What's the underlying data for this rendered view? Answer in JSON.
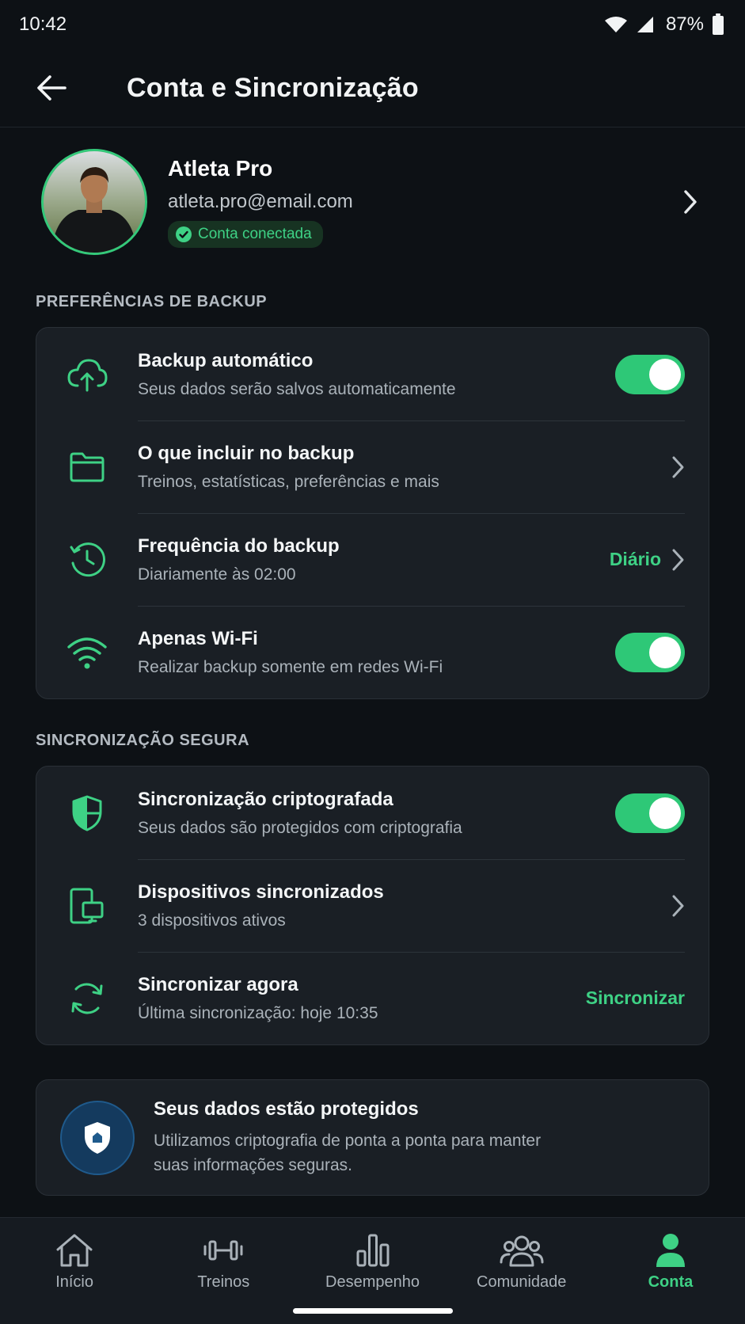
{
  "status_bar": {
    "time": "10:42",
    "battery": "87%"
  },
  "header": {
    "title": "Conta e Sincronização",
    "back_icon": "arrow-left-icon"
  },
  "profile": {
    "name": "Atleta Pro",
    "email": "atleta.pro@email.com",
    "badge": "Conta conectada"
  },
  "backup": {
    "section_title": "PREFERÊNCIAS DE BACKUP",
    "rows": [
      {
        "icon": "cloud-upload-icon",
        "title": "Backup automático",
        "subtitle": "Seus dados serão salvos automaticamente",
        "toggle": true
      },
      {
        "icon": "folder-icon",
        "title": "O que incluir no backup",
        "subtitle": "Treinos, estatísticas, preferências e mais"
      },
      {
        "icon": "clock-icon",
        "title": "Frequência do backup",
        "subtitle": "Diariamente às 02:00",
        "value": "Diário"
      },
      {
        "icon": "wifi-icon",
        "title": "Apenas Wi-Fi",
        "subtitle": "Realizar backup somente em redes Wi-Fi",
        "toggle": true
      }
    ]
  },
  "sync": {
    "section_title": "SINCRONIZAÇÃO SEGURA",
    "rows": [
      {
        "icon": "shield-icon",
        "title": "Sincronização criptografada",
        "subtitle": "Seus dados são protegidos com criptografia",
        "toggle": true
      },
      {
        "icon": "devices-icon",
        "title": "Dispositivos sincronizados",
        "subtitle": "3 dispositivos ativos"
      },
      {
        "icon": "sync-icon",
        "title": "Sincronizar agora",
        "subtitle": "Última sincronização: hoje 10:35",
        "action": "Sincronizar"
      }
    ]
  },
  "info": {
    "title": "Seus dados estão protegidos",
    "body": "Utilizamos criptografia de ponta a ponta para manter suas informações seguras."
  },
  "nav": {
    "items": [
      {
        "label": "Início",
        "icon": "home-icon"
      },
      {
        "label": "Treinos",
        "icon": "dumbbell-icon"
      },
      {
        "label": "Desempenho",
        "icon": "bar-chart-icon"
      },
      {
        "label": "Comunidade",
        "icon": "people-icon"
      },
      {
        "label": "Conta",
        "icon": "person-icon",
        "active": true
      }
    ]
  },
  "colors": {
    "accent": "#3ed185",
    "background": "#0d1115",
    "card": "#1a1f25"
  }
}
